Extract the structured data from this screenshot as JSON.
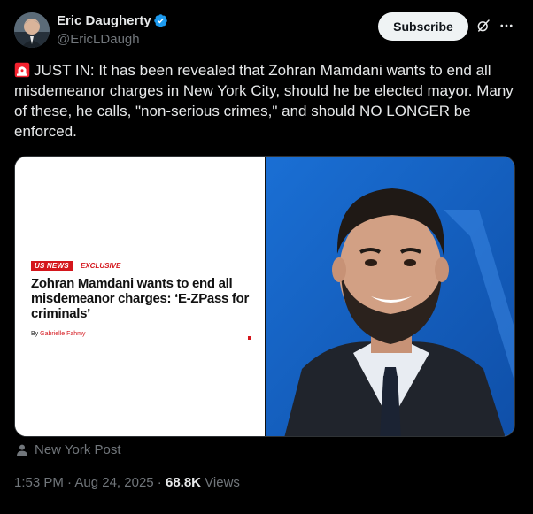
{
  "author": {
    "name": "Eric Daugherty",
    "handle": "@EricLDaugh",
    "verified_icon": "verified-badge-icon",
    "avatar": "avatar"
  },
  "actions": {
    "subscribe_label": "Subscribe",
    "grok_icon": "grok-icon",
    "more_icon": "more-icon"
  },
  "tweet": {
    "emoji": "siren-icon",
    "text": "JUST IN: It has been revealed that Zohran Mamdani wants to end all misdemeanor charges in New York City, should he be elected mayor. Many of these, he calls, \"non-serious crimes,\" and should NO LONGER be enforced."
  },
  "media": {
    "section_tag": "US NEWS",
    "exclusive_tag": "EXCLUSIVE",
    "headline": "Zohran Mamdani wants to end all misdemeanor charges: ‘E-ZPass for criminals’",
    "byline_prefix": "By ",
    "byline_author": "Gabrielle Fahmy"
  },
  "source": {
    "icon": "person-icon",
    "label": "New York Post"
  },
  "meta": {
    "time": "1:53 PM",
    "sep1": " · ",
    "date": "Aug 24, 2025",
    "sep2": " · ",
    "views_count": "68.8K",
    "views_label": " Views"
  },
  "colors": {
    "background": "#000000",
    "text": "#e7e9ea",
    "muted": "#71767b",
    "verified": "#1d9bf0",
    "post_red": "#d4161c"
  }
}
